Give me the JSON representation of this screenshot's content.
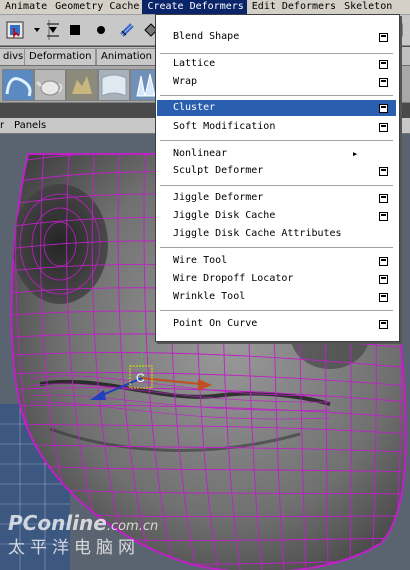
{
  "menubar": {
    "items": [
      "Animate",
      "Geometry Cache",
      "Create Deformers",
      "Edit Deformers",
      "Skeleton"
    ]
  },
  "shelf": {
    "tabs": [
      "divs",
      "Deformation",
      "Animation"
    ]
  },
  "panel": {
    "menu_label": "Panels"
  },
  "dropdown": {
    "items": [
      {
        "label": "Blend Shape",
        "option_box": true
      },
      {
        "label": "Lattice",
        "option_box": true
      },
      {
        "label": "Wrap",
        "option_box": true
      },
      {
        "label": "Cluster",
        "option_box": true,
        "highlighted": true
      },
      {
        "label": "Soft Modification",
        "option_box": true
      },
      {
        "label": "Nonlinear",
        "submenu": true
      },
      {
        "label": "Sculpt Deformer",
        "option_box": true
      },
      {
        "label": "Jiggle Deformer",
        "option_box": true
      },
      {
        "label": "Jiggle Disk Cache",
        "option_box": true
      },
      {
        "label": "Jiggle Disk Cache Attributes"
      },
      {
        "label": "Wire Tool",
        "option_box": true
      },
      {
        "label": "Wire Dropoff Locator",
        "option_box": true
      },
      {
        "label": "Wrinkle Tool",
        "option_box": true
      },
      {
        "label": "Point On Curve",
        "option_box": true
      }
    ]
  },
  "viewport": {
    "manipulator_label": "C"
  },
  "watermark": {
    "brand": "PConline",
    "domain": ".com.cn",
    "cn_text": "太平洋电脑网"
  },
  "colors": {
    "wireframe": "#c020c8",
    "highlight": "#2a5fb0",
    "menubar": "#d4d0c8",
    "mesh_fill": "#707070"
  }
}
